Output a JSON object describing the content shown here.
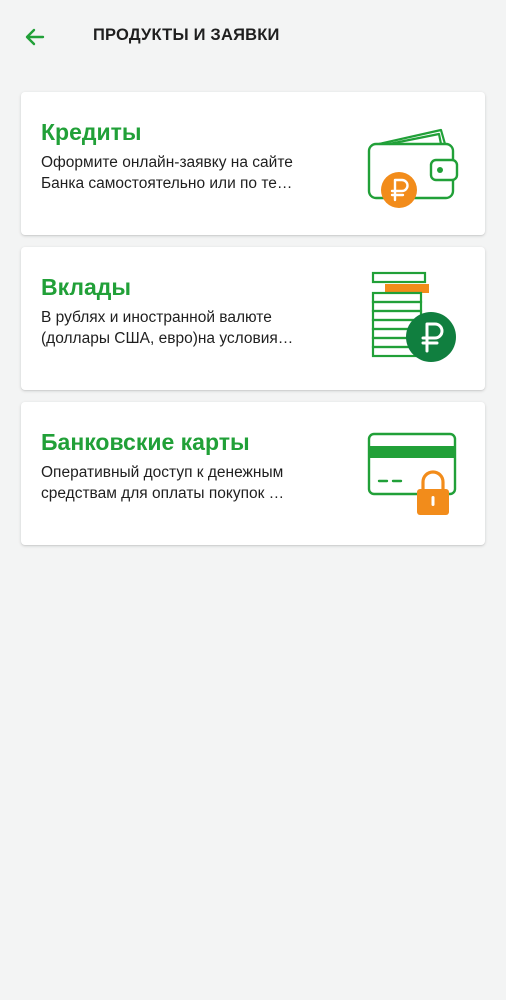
{
  "header": {
    "title": "ПРОДУКТЫ И ЗАЯВКИ"
  },
  "colors": {
    "accent_green": "#21a038",
    "dark_green": "#107f3f",
    "orange": "#f28c1b",
    "background": "#f3f4f4"
  },
  "products": [
    {
      "title": "Кредиты",
      "desc_line1": "Оформите онлайн-заявку на сайте",
      "desc_line2": "Банка самостоятельно или по те…",
      "icon": "wallet-ruble-icon"
    },
    {
      "title": "Вклады",
      "desc_line1": "В рублях и иностранной валюте",
      "desc_line2": "(доллары США, евро)на условия…",
      "icon": "coin-stack-ruble-icon"
    },
    {
      "title": "Банковские карты",
      "desc_line1": "Оперативный доступ к денежным",
      "desc_line2": "средствам для оплаты покупок …",
      "icon": "card-lock-icon"
    }
  ]
}
